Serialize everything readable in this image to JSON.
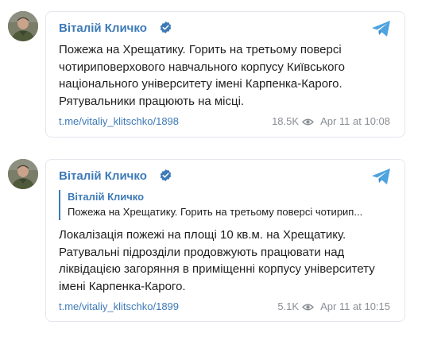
{
  "posts": [
    {
      "author": "Віталій Кличко",
      "verified_icon": "verified-badge-icon",
      "channel_icon": "telegram-icon",
      "text": "Пожежа на Хрещатику. Горить на третьому поверсі чотириповерхового навчального корпусу Київського національного університету імені Карпенка-Карого. Рятувальники працюють на місці.",
      "link": "t.me/vitaliy_klitschko/1898",
      "views": "18.5K",
      "views_icon": "eye-icon",
      "date": "Apr 11 at 10:08"
    },
    {
      "author": "Віталій Кличко",
      "verified_icon": "verified-badge-icon",
      "channel_icon": "telegram-icon",
      "reply": {
        "author": "Віталій Кличко",
        "text": "Пожежа на Хрещатику. Горить на третьому поверсі чотирип..."
      },
      "text": "Локалізація пожежі на площі 10 кв.м. на Хрещатику. Ратувальні підрозділи продовжують працювати над ліквідацією загоряння в приміщенні корпусу університету імені Карпенка-Карого.",
      "link": "t.me/vitaliy_klitschko/1899",
      "views": "5.1K",
      "views_icon": "eye-icon",
      "date": "Apr 11 at 10:15"
    }
  ],
  "colors": {
    "accent": "#3d7ab8",
    "telegram": "#4fa3df",
    "meta_text": "#8a8f95",
    "card_border": "#e3e7ec"
  }
}
